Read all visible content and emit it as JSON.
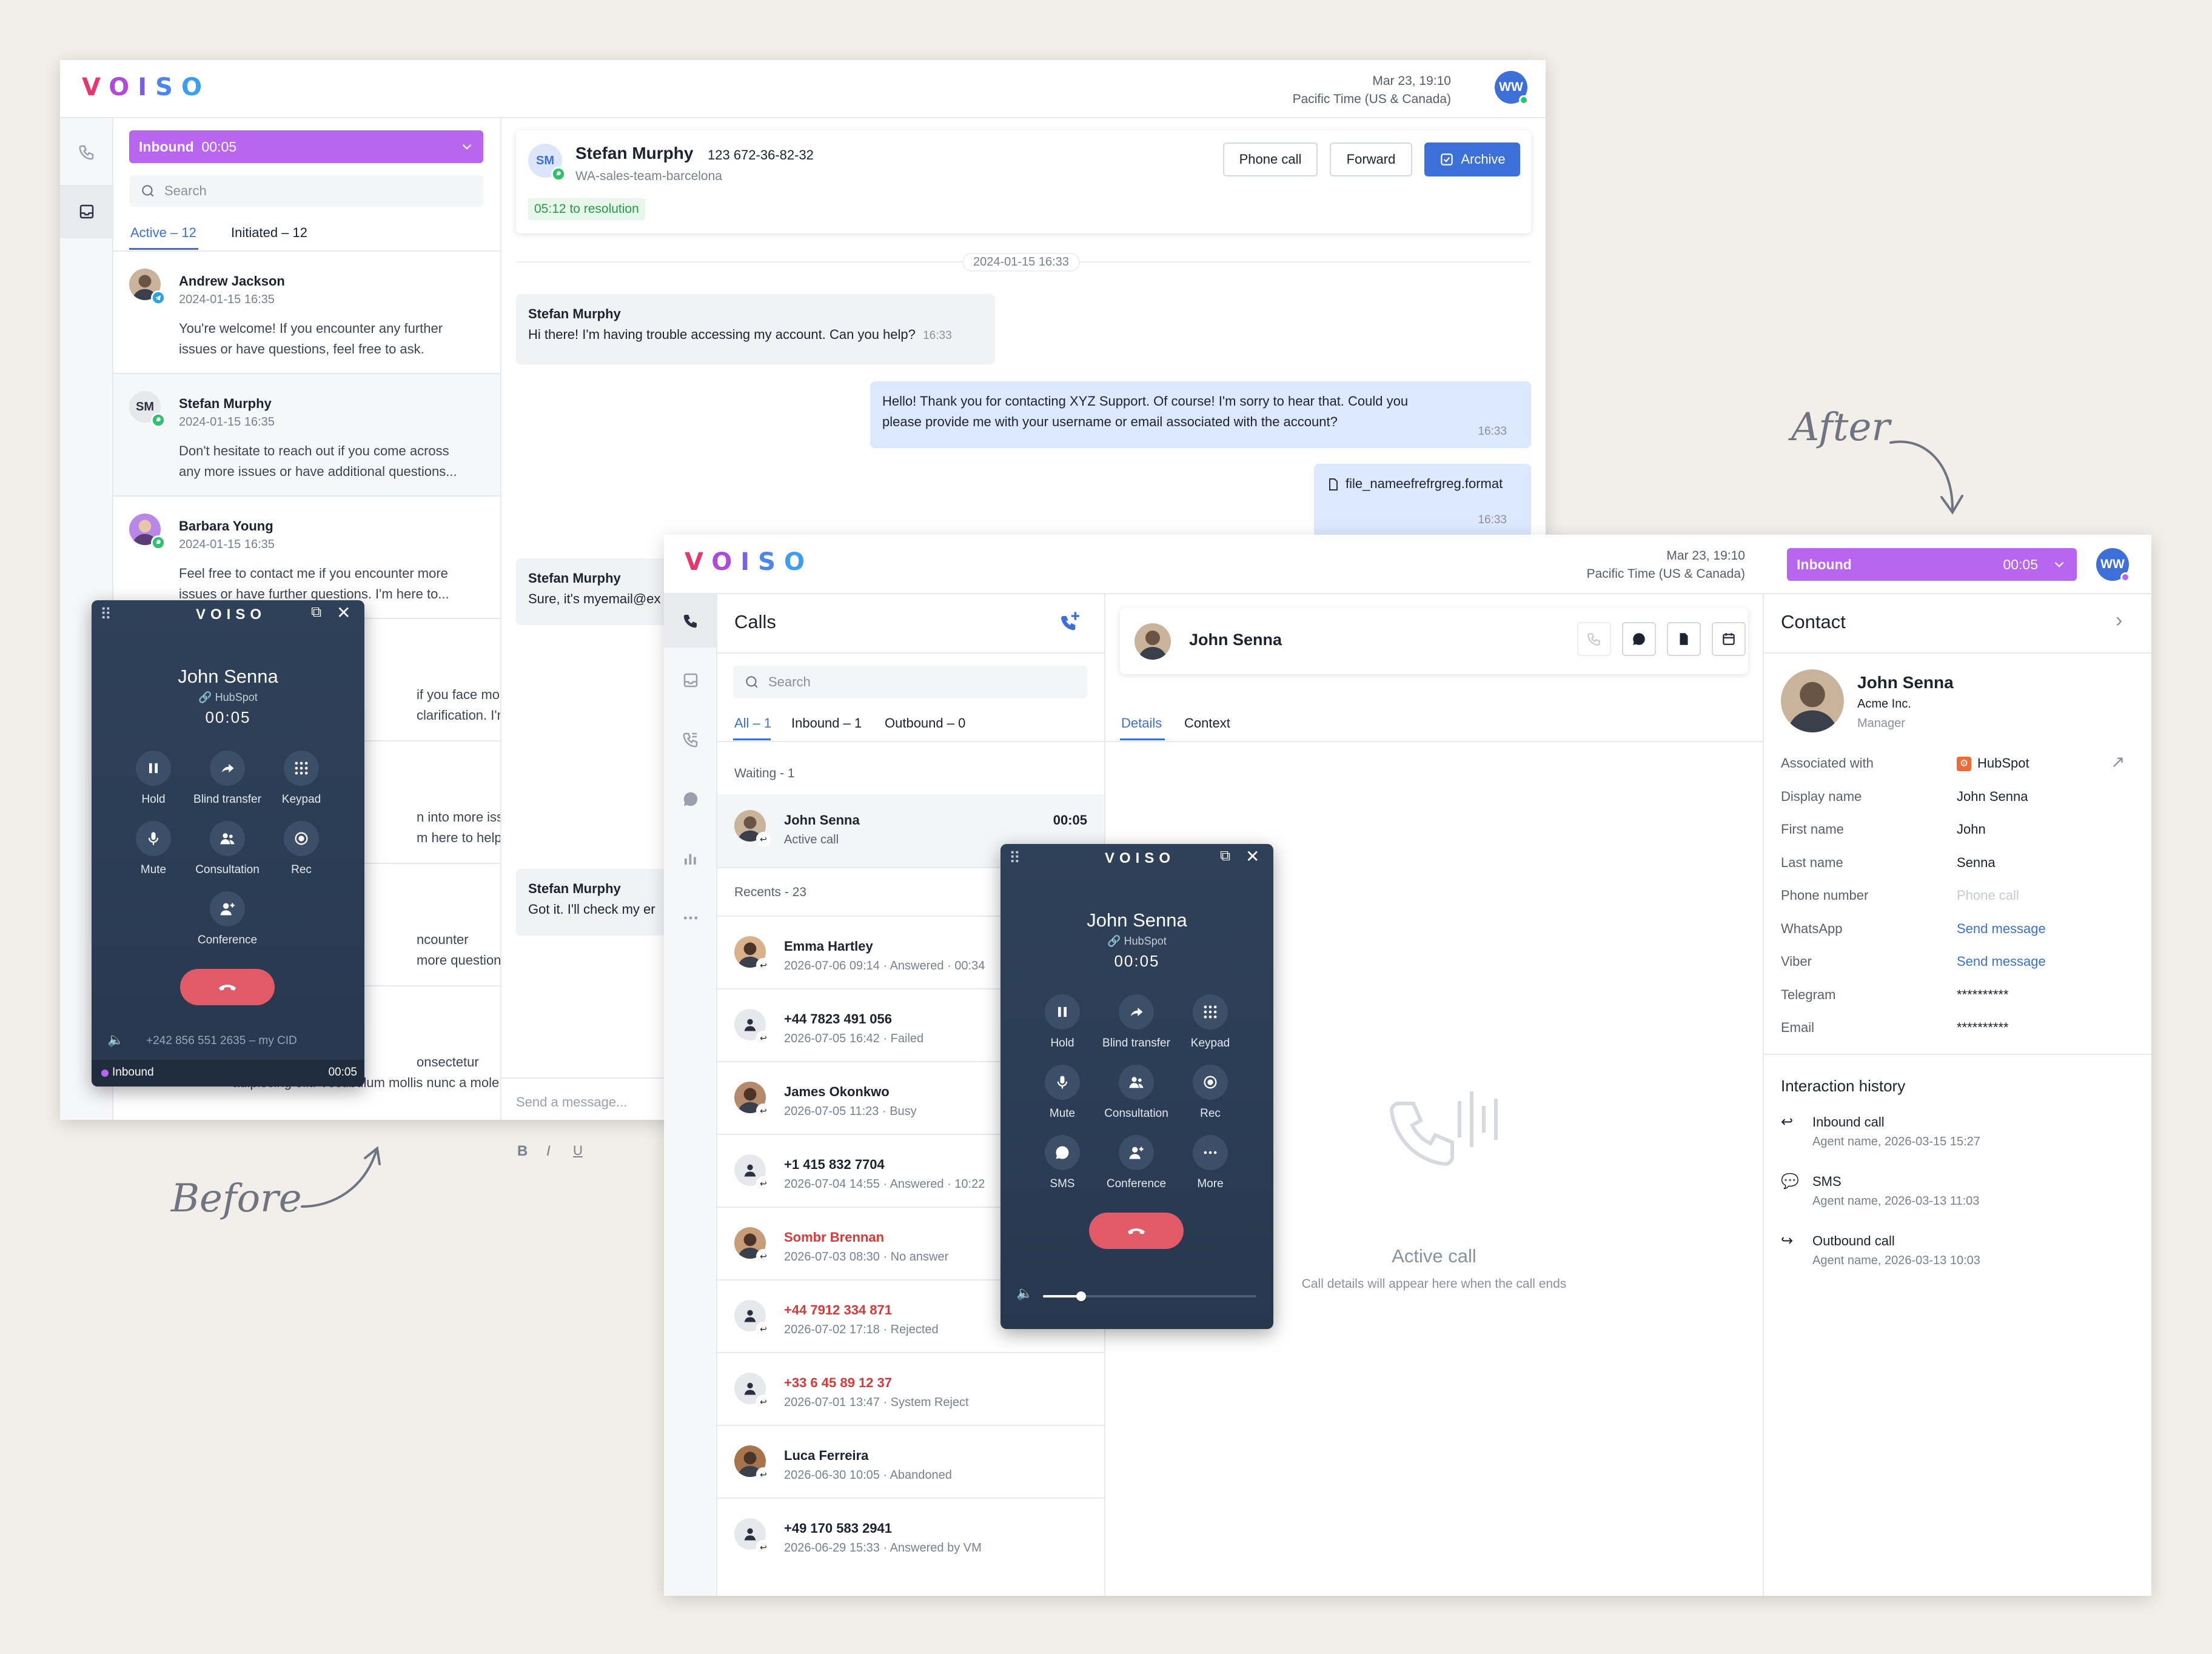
{
  "labels": {
    "before": "Before",
    "after": "After"
  },
  "logo": [
    "V",
    "O",
    "I",
    "S",
    "O"
  ],
  "colors": {
    "accent": "#3c70d8",
    "inbound": "#b866f0",
    "end_call": "#e05a68",
    "missed": "#d83a3a",
    "phone_bg": "#2f4158"
  },
  "before": {
    "header": {
      "date": "Mar 23, 19:10",
      "timezone": "Pacific Time (US & Canada)",
      "avatar": "WW"
    },
    "inbound_bar": {
      "label": "Inbound",
      "timer": "00:05"
    },
    "search_placeholder": "Search",
    "tabs": [
      {
        "label": "Active – 12"
      },
      {
        "label": "Initiated – 12"
      }
    ],
    "conversations": [
      {
        "name": "Andrew Jackson",
        "time": "2024-01-15 16:35",
        "preview1": "You're welcome! If you encounter any further",
        "preview2": "issues or have questions, feel free to ask.",
        "icon": "telegram-icon"
      },
      {
        "name": "Stefan Murphy",
        "initials": "SM",
        "time": "2024-01-15 16:35",
        "preview1": "Don't hesitate to reach out if you come across",
        "preview2": "any more issues or have additional questions...",
        "icon": "whatsapp-icon"
      },
      {
        "name": "Barbara Young",
        "time": "2024-01-15 16:35",
        "preview1": "Feel free to contact me if you encounter more",
        "preview2": "issues or have further questions. I'm here to...",
        "icon": "whatsapp-icon"
      }
    ],
    "partial_previews": [
      "if you face more",
      "clarification. I'm...",
      "n into more issues",
      "m here to help y...",
      "ncounter",
      "more questions...",
      "onsectetur",
      "adipiscing elit. Vestibulum mollis nunc a mole"
    ],
    "chat_header": {
      "initials": "SM",
      "name": "Stefan Murphy",
      "phone": "123 672-36-82-32",
      "team": "WA-sales-team-barcelona",
      "resolution": "05:12 to resolution",
      "phone_call": "Phone call",
      "forward": "Forward",
      "archive": "Archive"
    },
    "date_divider": "2024-01-15 16:33",
    "messages": [
      {
        "sender": "Stefan Murphy",
        "text": "Hi there! I'm having trouble accessing my account. Can you help?",
        "time": "16:33"
      },
      {
        "line1": "Hello! Thank you for contacting XYZ Support. Of course! I'm sorry to hear that. Could you",
        "line2": "please provide me with your username or email associated with the account?",
        "time": "16:33"
      },
      {
        "file": "file_nameefrefrgreg.format",
        "time": "16:33"
      },
      {
        "sender": "Stefan Murphy",
        "text": "Sure, it's myemail@ex"
      },
      {
        "sender": "Stefan Murphy",
        "text": "Got it. I'll check my er"
      }
    ],
    "composer": {
      "placeholder": "Send a message..."
    },
    "phone": {
      "logo": "VOISO",
      "name": "John Senna",
      "crm": "HubSpot",
      "timer": "00:05",
      "buttons": [
        "Hold",
        "Blind transfer",
        "Keypad",
        "Mute",
        "Consultation",
        "Rec",
        "Conference"
      ],
      "cid": "+242 856 551 2635 – my CID",
      "status": "Inbound",
      "status_timer": "00:05"
    }
  },
  "after": {
    "header": {
      "date": "Mar 23, 19:10",
      "timezone": "Pacific Time (US & Canada)",
      "avatar": "WW"
    },
    "inbound_bar": {
      "label": "Inbound",
      "timer": "00:05"
    },
    "calls": {
      "title": "Calls",
      "search_placeholder": "Search",
      "tabs": [
        {
          "label": "All – 1"
        },
        {
          "label": "Inbound – 1"
        },
        {
          "label": "Outbound – 0"
        }
      ],
      "waiting_label": "Waiting - 1",
      "active": {
        "name": "John Senna",
        "status": "Active call",
        "timer": "00:05"
      },
      "recents_label": "Recents - 23",
      "recents": [
        {
          "name": "Emma Hartley",
          "info": "2026-07-06 09:14 · Answered · 00:34",
          "missed": false
        },
        {
          "name": "+44 7823 491 056",
          "info": "2026-07-05 16:42 · Failed",
          "missed": false
        },
        {
          "name": "James Okonkwo",
          "info": "2026-07-05 11:23 · Busy",
          "missed": false
        },
        {
          "name": "+1 415 832 7704",
          "info": "2026-07-04 14:55 · Answered · 10:22",
          "missed": false
        },
        {
          "name": "Sombr Brennan",
          "info": "2026-07-03 08:30 · No answer",
          "missed": true
        },
        {
          "name": "+44 7912 334 871",
          "info": "2026-07-02 17:18 · Rejected",
          "missed": true
        },
        {
          "name": "+33 6 45 89 12 37",
          "info": "2026-07-01 13:47 · System Reject",
          "missed": true
        },
        {
          "name": "Luca Ferreira",
          "info": "2026-06-30 10:05 · Abandoned",
          "missed": false
        },
        {
          "name": "+49 170 583 2941",
          "info": "2026-06-29 15:33 · Answered by VM",
          "missed": false
        }
      ]
    },
    "detail": {
      "name": "John Senna",
      "tabs": [
        {
          "label": "Details"
        },
        {
          "label": "Context"
        }
      ],
      "empty_title": "Active call",
      "empty_sub": "Call details will appear here when the call ends"
    },
    "contact": {
      "title": "Contact",
      "name": "John Senna",
      "company": "Acme Inc.",
      "role": "Manager",
      "fields": [
        {
          "label": "Associated with",
          "value": "HubSpot"
        },
        {
          "label": "Display name",
          "value": "John Senna"
        },
        {
          "label": "First name",
          "value": "John"
        },
        {
          "label": "Last name",
          "value": "Senna"
        },
        {
          "label": "Phone number",
          "value": "Phone call"
        },
        {
          "label": "WhatsApp",
          "value": "Send message"
        },
        {
          "label": "Viber",
          "value": "Send message"
        },
        {
          "label": "Telegram",
          "value": "**********"
        },
        {
          "label": "Email",
          "value": "**********"
        }
      ],
      "history_title": "Interaction history",
      "history": [
        {
          "type": "Inbound call",
          "meta": "Agent name, 2026-03-15  15:27"
        },
        {
          "type": "SMS",
          "meta": "Agent name, 2026-03-13  11:03"
        },
        {
          "type": "Outbound call",
          "meta": "Agent name, 2026-03-13  10:03"
        }
      ]
    },
    "phone": {
      "logo": "VOISO",
      "name": "John Senna",
      "crm": "HubSpot",
      "timer": "00:05",
      "buttons": [
        "Hold",
        "Blind transfer",
        "Keypad",
        "Mute",
        "Consultation",
        "Rec",
        "SMS",
        "Conference",
        "More"
      ],
      "volume": 0.18
    }
  }
}
